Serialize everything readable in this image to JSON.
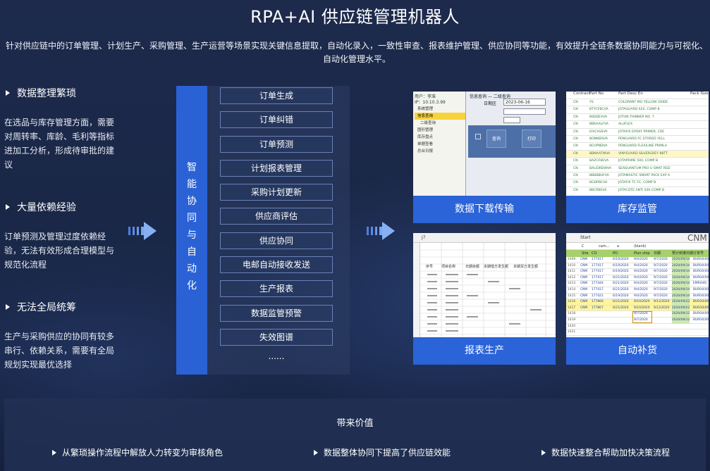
{
  "header": {
    "title": "RPA+AI 供应链管理机器人",
    "subtitle": "针对供应链中的订单管理、计划生产、采购管理、生产运营等场景实现关键信息提取，自动化录入，一致性审查、报表维护管理、供应协同等功能，有效提升全链条数据协同能力与可视化、自动化管理水平。"
  },
  "pain_points": [
    {
      "title": "数据整理繁琐",
      "text": "在选品与库存管理方面，需要对周转率、库龄、毛利等指标进加工分析，形成待审批的建议"
    },
    {
      "title": "大量依赖经验",
      "text": "订单预测及管理过度依赖经验，无法有效形成合理模型与规范化流程"
    },
    {
      "title": "无法全局统筹",
      "text": "生产与采购供应的协同有较多串行、依赖关系，需要有全局规划实现最优选择"
    }
  ],
  "middle": {
    "vertical_label": "智能协同与自动化",
    "functions": [
      "订单生成",
      "订单纠错",
      "订单预测",
      "计划报表管理",
      "采购计划更新",
      "供应商评估",
      "供应协同",
      "电邮自动接收发送",
      "生产报表",
      "数据监管预警",
      "失效图谱"
    ],
    "more": "......"
  },
  "cards": [
    {
      "caption": "数据下载传输"
    },
    {
      "caption": "库存监管"
    },
    {
      "caption": "报表生产"
    },
    {
      "caption": "自动补货"
    }
  ],
  "card_screens": {
    "download": {
      "user_label": "用户：李准",
      "ip_label": "IP：10.10.3.99",
      "menu": [
        "系统管理",
        "信息查询",
        "二级查询",
        "图形管理",
        "库存盘点",
        "单据查看",
        "总台日报"
      ],
      "form_title": "信息查询 — 二级查询",
      "date_label": "日期区",
      "date_value": "2023-06-16",
      "buttons": [
        "查询",
        "打印"
      ]
    },
    "inventory": {
      "headers": [
        "Contract",
        "Part No",
        "Part Desc En",
        "Pack Size"
      ],
      "rows": [
        [
          "CN",
          "YS",
          "COLORANT MO YELLOW OXIDE"
        ],
        [
          "CN",
          "BTYCFBCVA",
          "JOTAGUARD 620, COMP B"
        ],
        [
          "CN",
          "BSDDEVVA",
          "JOTUN THINNER NO. 7"
        ],
        [
          "CN",
          "BBKAALFVA",
          "ALUFLEX"
        ],
        [
          "CN",
          "EIVCASSVA",
          "JOTAFIX EPOXY PRIMER, CRE"
        ],
        [
          "CN",
          "BONNDSVA",
          "PENGUARD FC STORED YELL"
        ],
        [
          "CN",
          "BCHPNDVA",
          "PENGUARD FLEX/LINE PRIMLA"
        ],
        [
          "CN",
          "BBNAATWVA",
          "VINYGUARD SILVERGREY 88TT"
        ],
        [
          "CN",
          "BAZCF8EVA",
          "JOTAPRIME 500, COMP B"
        ],
        [
          "CN",
          "BALIDRDWVA",
          "SEAQUANTUM PRO U SMAT RED"
        ],
        [
          "CN",
          "BBBBBUFVA",
          "JOTAMASTIC SMART PACK EXP A"
        ],
        [
          "CN",
          "BGDPBCVA",
          "JOTAFIX TC FC, COMP B"
        ],
        [
          "CN",
          "BBCPBEVA",
          "JOTACOTE ANTI 500 COMP B"
        ]
      ]
    },
    "report": {
      "cell_ref": "J7",
      "headers": [
        "序号",
        "项目名称",
        "日期余额",
        "本期借方发生额",
        "本期贷方发生额"
      ]
    },
    "replenish": {
      "tab_label": "Start",
      "brand": "CNM",
      "filter_values": [
        "C",
        "cam...",
        "a",
        "(blank)"
      ],
      "headers": [
        "Site",
        "CO",
        "PO",
        "Plan ship",
        "日期",
        "预计到港日期",
        "订单号"
      ],
      "rows": [
        [
          "1409",
          "CNM",
          "177417",
          "6/19/2020",
          "9/4/2020",
          "9/7/2020",
          "2020/09/14",
          "BUR04(000"
        ],
        [
          "1410",
          "CNM",
          "177417",
          "6/19/2020",
          "9/4/2020",
          "9/7/2020",
          "2020/09/14",
          "BUR04(000"
        ],
        [
          "1411",
          "CNM",
          "177417",
          "6/19/2020",
          "9/4/2020",
          "9/7/2020",
          "2020/09/14",
          "BUR04(000"
        ],
        [
          "1412",
          "CNM",
          "177417",
          "6/21/2020",
          "9/4/2020",
          "9/7/2020",
          "2020/09/14",
          "BUR04(000"
        ],
        [
          "1413",
          "CNM",
          "177444",
          "6/21/2020",
          "9/4/2020",
          "9/7/2020",
          "2020/09/14",
          "EMR046)"
        ],
        [
          "1414",
          "CNM",
          "177417",
          "6/21/2020",
          "9/4/2020",
          "9/7/2020",
          "2020/09/14",
          "BUR04(000"
        ],
        [
          "1415",
          "CNM",
          "177421",
          "6/19/2020",
          "9/4/2020",
          "9/7/2020",
          "2020/09/14",
          "BUR04(000"
        ],
        [
          "1416",
          "CNM",
          "177866",
          "6/21/2020",
          "9/10/2020",
          "9/12/2020",
          "2020/09/22",
          "BUR20(000"
        ],
        [
          "1417",
          "CNM",
          "177867",
          "6/21/2020",
          "9/10/2020",
          "9/12/2020",
          "2020/09/22",
          "BUR20(000"
        ],
        [
          "1418",
          "",
          "",
          "",
          "9/7/2020",
          "",
          "2020/09/12",
          "BUR04(000"
        ],
        [
          "1419",
          "",
          "",
          "",
          "9/7/2020",
          "",
          "2020/09/12",
          "BUR04(000"
        ],
        [
          "1420",
          "",
          "",
          "",
          "",
          "",
          "",
          ""
        ],
        [
          "1421",
          "",
          "",
          "",
          "",
          "",
          "",
          ""
        ]
      ]
    }
  },
  "value": {
    "title": "带来价值",
    "items": [
      "从繁琐操作流程中解放人力转变为审核角色",
      "数据整体协同下提高了供应链效能",
      "数据快速整合帮助加快决策流程"
    ]
  },
  "colors": {
    "accent": "#2b63d8",
    "background": "#1d2a4c"
  },
  "icons": [
    "double-chevron-right-icon",
    "triangle-bullet-icon"
  ]
}
